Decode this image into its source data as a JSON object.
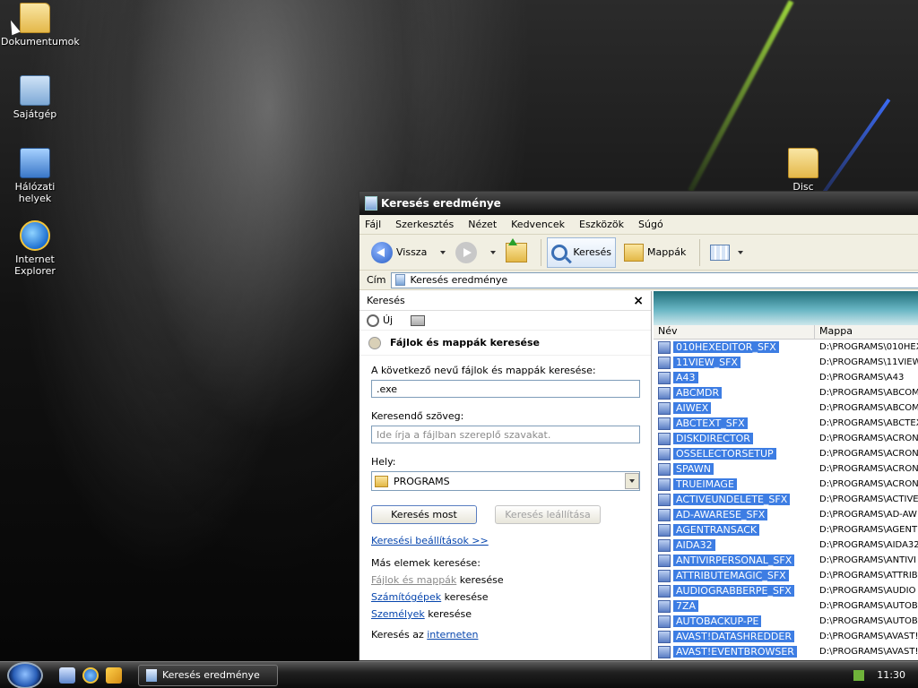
{
  "desktop": {
    "icons": [
      {
        "label": "Dokumentumok",
        "icon": "folder-icon"
      },
      {
        "label": "Sajátgép",
        "icon": "computer-icon"
      },
      {
        "label": "Hálózati helyek",
        "icon": "network-icon"
      },
      {
        "label": "Internet Explorer",
        "icon": "ie-icon"
      },
      {
        "label": "Disc Programs",
        "icon": "folder-icon"
      }
    ]
  },
  "window": {
    "title": "Keresés eredménye",
    "menu": [
      "Fájl",
      "Szerkesztés",
      "Nézet",
      "Kedvencek",
      "Eszközök",
      "Súgó"
    ],
    "toolbar": {
      "back": "Vissza",
      "search": "Keresés",
      "folders": "Mappák"
    },
    "address": {
      "label": "Cím",
      "value": "Keresés eredménye"
    }
  },
  "search_pane": {
    "header": "Keresés",
    "new_label": "Új",
    "title": "Fájlok és mappák keresése",
    "name_label": "A következő nevű fájlok és mappák keresése:",
    "name_value": ".exe",
    "text_label": "Keresendő szöveg:",
    "text_placeholder": "Ide írja a fájlban szereplő szavakat.",
    "location_label": "Hely:",
    "location_value": "PROGRAMS",
    "search_now": "Keresés most",
    "stop_search": "Keresés leállítása",
    "search_options": "Keresési beállítások >>",
    "other_label": "Más elemek keresése:",
    "other_items": [
      {
        "link": "Fájlok és mappák",
        "suffix": " keresése"
      },
      {
        "link": "Számítógépek",
        "suffix": " keresése"
      },
      {
        "link": "Személyek",
        "suffix": " keresése"
      }
    ],
    "internet_prefix": "Keresés az ",
    "internet_link": "interneten"
  },
  "results": {
    "columns": {
      "name": "Név",
      "folder": "Mappa"
    },
    "rows": [
      {
        "name": "010HEXEDITOR_SFX",
        "folder": "D:\\PROGRAMS\\010HEX"
      },
      {
        "name": "11VIEW_SFX",
        "folder": "D:\\PROGRAMS\\11VIEW"
      },
      {
        "name": "A43",
        "folder": "D:\\PROGRAMS\\A43"
      },
      {
        "name": "ABCMDR",
        "folder": "D:\\PROGRAMS\\ABCOM"
      },
      {
        "name": "AIWEX",
        "folder": "D:\\PROGRAMS\\ABCOM"
      },
      {
        "name": "ABCTEXT_SFX",
        "folder": "D:\\PROGRAMS\\ABCTEX"
      },
      {
        "name": "DISKDIRECTOR",
        "folder": "D:\\PROGRAMS\\ACRON"
      },
      {
        "name": "OSSELECTORSETUP",
        "folder": "D:\\PROGRAMS\\ACRON"
      },
      {
        "name": "SPAWN",
        "folder": "D:\\PROGRAMS\\ACRON"
      },
      {
        "name": "TRUEIMAGE",
        "folder": "D:\\PROGRAMS\\ACRON"
      },
      {
        "name": "ACTIVEUNDELETE_SFX",
        "folder": "D:\\PROGRAMS\\ACTIVE"
      },
      {
        "name": "AD-AWARESE_SFX",
        "folder": "D:\\PROGRAMS\\AD-AW"
      },
      {
        "name": "AGENTRANSACK",
        "folder": "D:\\PROGRAMS\\AGENT"
      },
      {
        "name": "AIDA32",
        "folder": "D:\\PROGRAMS\\AIDA32"
      },
      {
        "name": "ANTIVIRPERSONAL_SFX",
        "folder": "D:\\PROGRAMS\\ANTIVI"
      },
      {
        "name": "ATTRIBUTEMAGIC_SFX",
        "folder": "D:\\PROGRAMS\\ATTRIB"
      },
      {
        "name": "AUDIOGRABBERPE_SFX",
        "folder": "D:\\PROGRAMS\\AUDIO"
      },
      {
        "name": "7ZA",
        "folder": "D:\\PROGRAMS\\AUTOB"
      },
      {
        "name": "AUTOBACKUP-PE",
        "folder": "D:\\PROGRAMS\\AUTOB"
      },
      {
        "name": "AVAST!DATASHREDDER",
        "folder": "D:\\PROGRAMS\\AVAST!"
      },
      {
        "name": "AVAST!EVENTBROWSER",
        "folder": "D:\\PROGRAMS\\AVAST!"
      }
    ]
  },
  "taskbar": {
    "task_title": "Keresés eredménye",
    "clock": "11:30"
  },
  "colors": {
    "selection": "#3d7de3",
    "link": "#0645ad"
  }
}
